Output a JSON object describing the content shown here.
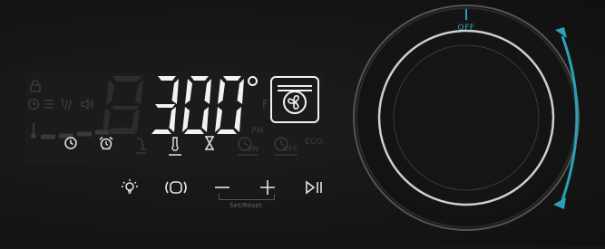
{
  "display": {
    "temperature": "300",
    "unit_symbol": "°",
    "mode": "convection-fan"
  },
  "status_icons": [
    {
      "name": "timer-icon",
      "active": true
    },
    {
      "name": "alarm-clock-icon",
      "active": true
    },
    {
      "name": "probe-icon",
      "active": false
    },
    {
      "name": "thermometer-icon",
      "active": true
    },
    {
      "name": "hourglass-icon",
      "active": true
    },
    {
      "name": "on-timer-icon",
      "active": false
    },
    {
      "name": "off-timer-icon",
      "active": false
    }
  ],
  "ghost_labels": {
    "fahrenheit": "F",
    "pm": "PM",
    "on": "ON",
    "off": "OFF",
    "eco": "ECO"
  },
  "controls": {
    "set_reset_label": "Set/Reset"
  },
  "knob": {
    "off_label": "OFF"
  },
  "colors": {
    "accent": "#2aa1b6",
    "display_lit": "#f2f2f2",
    "display_unlit": "#3a3a3a"
  }
}
